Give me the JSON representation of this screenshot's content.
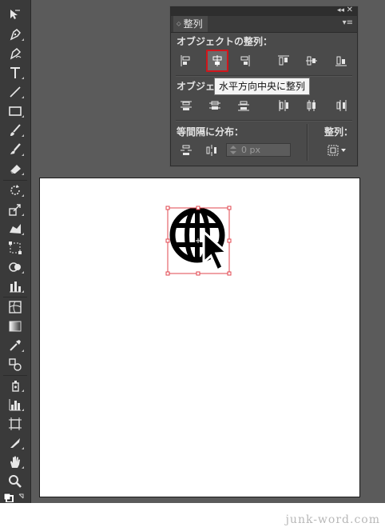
{
  "panel": {
    "tab_title": "整列",
    "align_objects_label": "オブジェクトの整列：",
    "distribute_objects_label": "オブジェ",
    "distribute_spacing_label": "等間隔に分布：",
    "align_to_label": "整列：",
    "spacing_value": "0 px"
  },
  "tooltip": {
    "text": "水平方向中央に整列"
  },
  "toolbar": {
    "tools": [
      "selection-tool",
      "direct-selection-tool",
      "magic-wand-tool",
      "pen-tool",
      "curvature-tool",
      "type-tool",
      "line-tool",
      "rectangle-tool",
      "paintbrush-tool",
      "blob-brush-tool",
      "eraser-tool",
      "rotate-tool",
      "scale-tool",
      "puppet-warp-tool",
      "free-transform-tool",
      "shape-builder-tool",
      "graph-tool",
      "mesh-tool",
      "gradient-tool",
      "eyedropper-tool",
      "blend-tool",
      "symbol-sprayer-tool",
      "column-graph-tool",
      "artboard-tool",
      "slice-tool",
      "hand-tool",
      "zoom-tool",
      "fill-stroke-swatch"
    ]
  },
  "colors": {
    "active_outline": "#d0161c",
    "selection_box": "#e1444d"
  },
  "credit": "junk-word.com"
}
